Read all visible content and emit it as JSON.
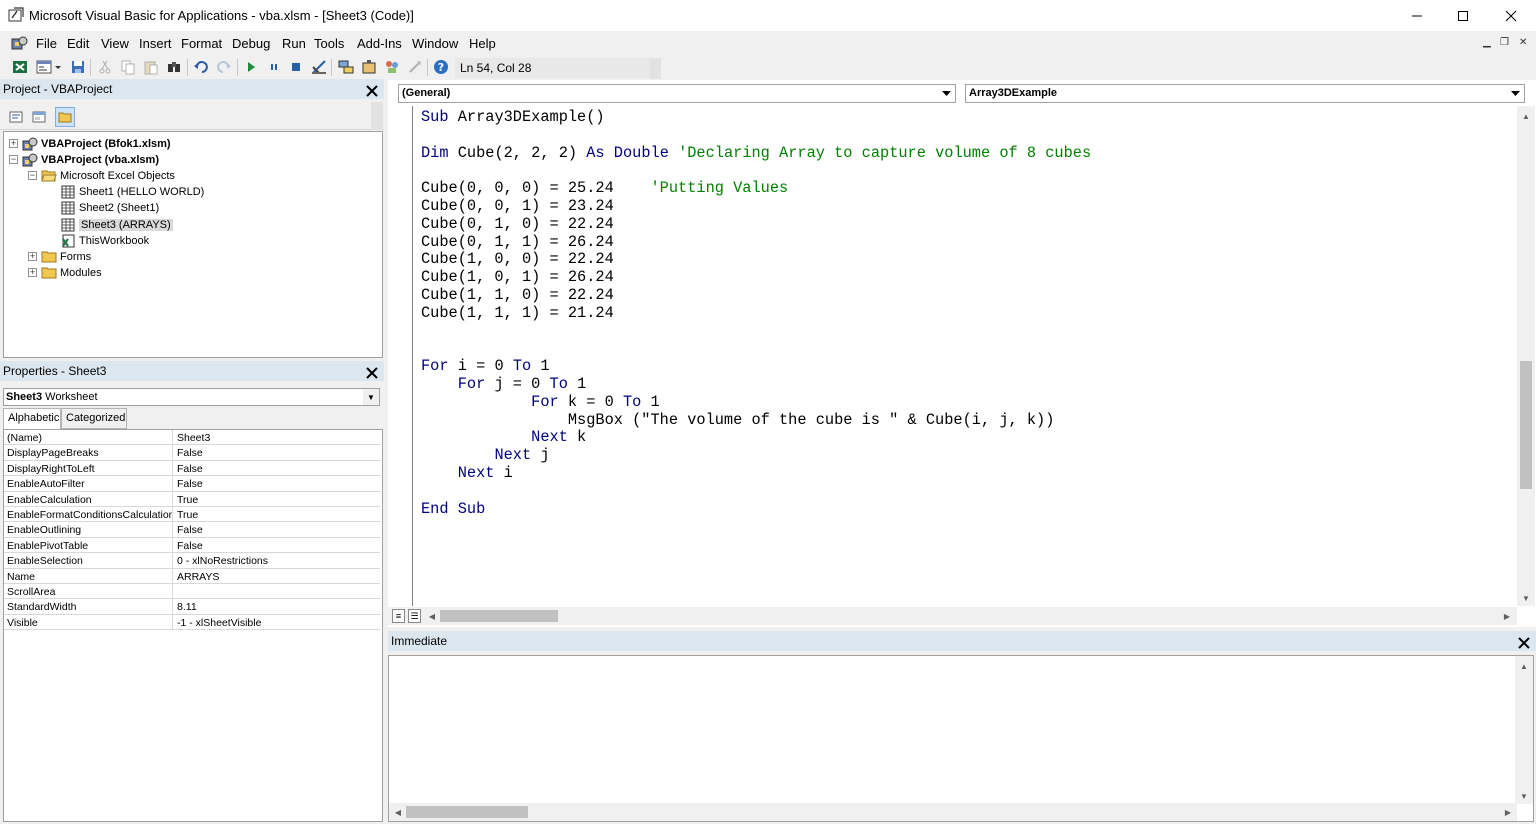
{
  "window": {
    "title": "Microsoft Visual Basic for Applications - vba.xlsm - [Sheet3 (Code)]",
    "minimize_glyph": "—",
    "maximize_glyph": "☐",
    "close_glyph": "✕"
  },
  "menu": [
    "File",
    "Edit",
    "View",
    "Insert",
    "Format",
    "Debug",
    "Run",
    "Tools",
    "Add-Ins",
    "Window",
    "Help"
  ],
  "toolbar": {
    "icons": [
      "view-excel-icon",
      "insert-userform-icon",
      "dropdown-icon",
      "save-icon",
      "cut-icon",
      "copy-icon",
      "paste-icon",
      "find-icon",
      "undo-icon",
      "redo-icon",
      "run-icon",
      "break-icon",
      "reset-icon",
      "design-mode-icon",
      "project-explorer-icon",
      "properties-window-icon",
      "object-browser-icon",
      "toolbox-icon",
      "help-icon"
    ],
    "cursor_position": "Ln 54, Col 28"
  },
  "project_panel": {
    "title": "Project - VBAProject",
    "tree": [
      {
        "label": "VBAProject (Bfok1.xlsm)",
        "level": 0,
        "bold": true,
        "icon": "vba-project-icon",
        "expander": "+"
      },
      {
        "label": "VBAProject (vba.xlsm)",
        "level": 0,
        "bold": true,
        "icon": "vba-project-icon",
        "expander": "−"
      },
      {
        "label": "Microsoft Excel Objects",
        "level": 1,
        "icon": "folder-open-icon",
        "expander": "−"
      },
      {
        "label": "Sheet1 (HELLO WORLD)",
        "level": 2,
        "icon": "worksheet-icon"
      },
      {
        "label": "Sheet2 (Sheet1)",
        "level": 2,
        "icon": "worksheet-icon"
      },
      {
        "label": "Sheet3 (ARRAYS)",
        "level": 2,
        "icon": "worksheet-icon",
        "selected": true
      },
      {
        "label": "ThisWorkbook",
        "level": 2,
        "icon": "workbook-icon"
      },
      {
        "label": "Forms",
        "level": 1,
        "icon": "folder-icon",
        "expander": "+"
      },
      {
        "label": "Modules",
        "level": 1,
        "icon": "folder-icon",
        "expander": "+"
      }
    ]
  },
  "properties_panel": {
    "title": "Properties - Sheet3",
    "object_name": "Sheet3",
    "object_type": "Worksheet",
    "tabs": [
      "Alphabetic",
      "Categorized"
    ],
    "rows": [
      {
        "name": "(Name)",
        "value": "Sheet3"
      },
      {
        "name": "DisplayPageBreaks",
        "value": "False"
      },
      {
        "name": "DisplayRightToLeft",
        "value": "False"
      },
      {
        "name": "EnableAutoFilter",
        "value": "False"
      },
      {
        "name": "EnableCalculation",
        "value": "True"
      },
      {
        "name": "EnableFormatConditionsCalculation",
        "value": "True"
      },
      {
        "name": "EnableOutlining",
        "value": "False"
      },
      {
        "name": "EnablePivotTable",
        "value": "False"
      },
      {
        "name": "EnableSelection",
        "value": "0 - xlNoRestrictions"
      },
      {
        "name": "Name",
        "value": "ARRAYS"
      },
      {
        "name": "ScrollArea",
        "value": ""
      },
      {
        "name": "StandardWidth",
        "value": "8.11"
      },
      {
        "name": "Visible",
        "value": "-1 - xlSheetVisible"
      }
    ]
  },
  "code_window": {
    "object_combo": "(General)",
    "procedure_combo": "Array3DExample",
    "lines": [
      [
        {
          "t": "Sub",
          "k": "kw"
        },
        {
          "t": " Array3DExample()"
        }
      ],
      [],
      [
        {
          "t": "Dim",
          "k": "kw"
        },
        {
          "t": " Cube(2, 2, 2) "
        },
        {
          "t": "As",
          "k": "kw"
        },
        {
          "t": " "
        },
        {
          "t": "Double",
          "k": "kw"
        },
        {
          "t": " "
        },
        {
          "t": "'Declaring Array to capture volume of 8 cubes",
          "k": "cm"
        }
      ],
      [],
      [
        {
          "t": "Cube(0, 0, 0) = 25.24    "
        },
        {
          "t": "'Putting Values",
          "k": "cm"
        }
      ],
      [
        {
          "t": "Cube(0, 0, 1) = 23.24"
        }
      ],
      [
        {
          "t": "Cube(0, 1, 0) = 22.24"
        }
      ],
      [
        {
          "t": "Cube(0, 1, 1) = 26.24"
        }
      ],
      [
        {
          "t": "Cube(1, 0, 0) = 22.24"
        }
      ],
      [
        {
          "t": "Cube(1, 0, 1) = 26.24"
        }
      ],
      [
        {
          "t": "Cube(1, 1, 0) = 22.24"
        }
      ],
      [
        {
          "t": "Cube(1, 1, 1) = 21.24"
        }
      ],
      [],
      [],
      [
        {
          "t": "For",
          "k": "kw"
        },
        {
          "t": " i = 0 "
        },
        {
          "t": "To",
          "k": "kw"
        },
        {
          "t": " 1"
        }
      ],
      [
        {
          "t": "    "
        },
        {
          "t": "For",
          "k": "kw"
        },
        {
          "t": " j = 0 "
        },
        {
          "t": "To",
          "k": "kw"
        },
        {
          "t": " 1"
        }
      ],
      [
        {
          "t": "            "
        },
        {
          "t": "For",
          "k": "kw"
        },
        {
          "t": " k = 0 "
        },
        {
          "t": "To",
          "k": "kw"
        },
        {
          "t": " 1"
        }
      ],
      [
        {
          "t": "                MsgBox (\"The volume of the cube is \" & Cube(i, j, k))"
        }
      ],
      [
        {
          "t": "            "
        },
        {
          "t": "Next",
          "k": "kw"
        },
        {
          "t": " k"
        }
      ],
      [
        {
          "t": "        "
        },
        {
          "t": "Next",
          "k": "kw"
        },
        {
          "t": " j"
        }
      ],
      [
        {
          "t": "    "
        },
        {
          "t": "Next",
          "k": "kw"
        },
        {
          "t": " i"
        }
      ],
      [],
      [
        {
          "t": "End Sub",
          "k": "kw"
        }
      ]
    ]
  },
  "immediate_panel": {
    "title": "Immediate",
    "content": ""
  },
  "colors": {
    "keyword": "#00007f",
    "comment": "#008000",
    "panel_title_bg": "#dce6ef"
  }
}
